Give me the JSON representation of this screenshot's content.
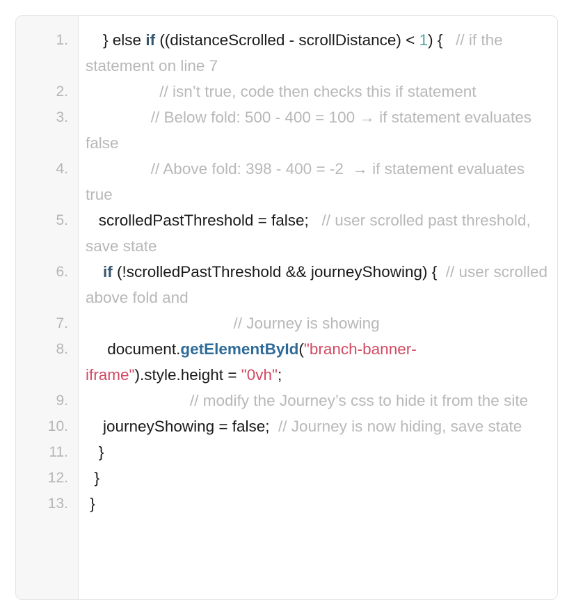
{
  "viewer": {
    "kind": "code-snippet",
    "language": "javascript",
    "line_count": 13,
    "colors": {
      "background": "#ffffff",
      "card_border": "#e3e3e3",
      "gutter_background": "#f7f7f7",
      "line_number": "#b5b5b5",
      "text": "#1a1a1a",
      "keyword": "#35566e",
      "function": "#2f6b99",
      "string": "#d14a63",
      "number": "#4aa89a",
      "comment": "#b8b8b8"
    }
  },
  "gutter": {
    "numbers": [
      "1.",
      "2.",
      "3.",
      "4.",
      "5.",
      "6.",
      "7.",
      "8.",
      "9.",
      "10.",
      "11.",
      "12.",
      "13."
    ]
  },
  "code": {
    "lines": [
      {
        "number": "1.",
        "plain_text": "    } else if ((distanceScrolled - scrollDistance) < 1) {   // if the statement on line 7",
        "tokens": [
          {
            "type": "plain",
            "text": "    } else "
          },
          {
            "type": "keyword",
            "text": "if"
          },
          {
            "type": "plain",
            "text": " ((distanceScrolled - scrollDistance) < "
          },
          {
            "type": "number",
            "text": "1"
          },
          {
            "type": "plain",
            "text": ") {   "
          },
          {
            "type": "comment",
            "text": "// if the statement on line 7"
          }
        ]
      },
      {
        "number": "2.",
        "plain_text": "                 // isn’t true, code then checks this if statement",
        "tokens": [
          {
            "type": "plain",
            "text": "                 "
          },
          {
            "type": "comment",
            "text": "// isn’t true, code then checks this if statement"
          }
        ]
      },
      {
        "number": "3.",
        "plain_text": "               // Below fold: 500 - 400 = 100 → if statement evaluates false",
        "tokens": [
          {
            "type": "plain",
            "text": "               "
          },
          {
            "type": "comment",
            "text": "// Below fold: 500 - 400 = 100 → if statement evaluates false"
          }
        ]
      },
      {
        "number": "4.",
        "plain_text": "               // Above fold: 398 - 400 = -2  → if statement evaluates true",
        "tokens": [
          {
            "type": "plain",
            "text": "               "
          },
          {
            "type": "comment",
            "text": "// Above fold: 398 - 400 = -2  → if statement evaluates true"
          }
        ]
      },
      {
        "number": "5.",
        "plain_text": "   scrolledPastThreshold = false;   // user scrolled past threshold, save state",
        "tokens": [
          {
            "type": "plain",
            "text": "   scrolledPastThreshold = false;   "
          },
          {
            "type": "comment",
            "text": "// user scrolled past threshold, save state"
          }
        ]
      },
      {
        "number": "6.",
        "plain_text": "    if (!scrolledPastThreshold && journeyShowing) {  // user scrolled above fold and",
        "tokens": [
          {
            "type": "plain",
            "text": "    "
          },
          {
            "type": "keyword",
            "text": "if"
          },
          {
            "type": "plain",
            "text": " (!scrolledPastThreshold && journeyShowing) {  "
          },
          {
            "type": "comment",
            "text": "// user scrolled above fold and"
          }
        ]
      },
      {
        "number": "7.",
        "plain_text": "                                  // Journey is showing",
        "tokens": [
          {
            "type": "plain",
            "text": "                                  "
          },
          {
            "type": "comment",
            "text": "// Journey is showing"
          }
        ]
      },
      {
        "number": "8.",
        "plain_text": "     document.getElementById(\"branch-banner-iframe\").style.height = \"0vh\";",
        "tokens": [
          {
            "type": "plain",
            "text": "     document."
          },
          {
            "type": "function",
            "text": "getElementById"
          },
          {
            "type": "plain",
            "text": "("
          },
          {
            "type": "string",
            "text": "\"branch-banner-iframe\""
          },
          {
            "type": "plain",
            "text": ").style.height = "
          },
          {
            "type": "string",
            "text": "\"0vh\""
          },
          {
            "type": "plain",
            "text": ";"
          }
        ]
      },
      {
        "number": "9.",
        "plain_text": "                        // modify the Journey’s css to hide it from the site",
        "tokens": [
          {
            "type": "plain",
            "text": "                        "
          },
          {
            "type": "comment",
            "text": "// modify the Journey’s css to hide it from the site"
          }
        ]
      },
      {
        "number": "10.",
        "plain_text": "    journeyShowing = false;  // Journey is now hiding, save state",
        "tokens": [
          {
            "type": "plain",
            "text": "    journeyShowing = false;  "
          },
          {
            "type": "comment",
            "text": "// Journey is now hiding, save state"
          }
        ]
      },
      {
        "number": "11.",
        "plain_text": "   }",
        "tokens": [
          {
            "type": "plain",
            "text": "   }"
          }
        ]
      },
      {
        "number": "12.",
        "plain_text": "  }",
        "tokens": [
          {
            "type": "plain",
            "text": "  }"
          }
        ]
      },
      {
        "number": "13.",
        "plain_text": " }",
        "tokens": [
          {
            "type": "plain",
            "text": " }"
          }
        ]
      }
    ]
  }
}
